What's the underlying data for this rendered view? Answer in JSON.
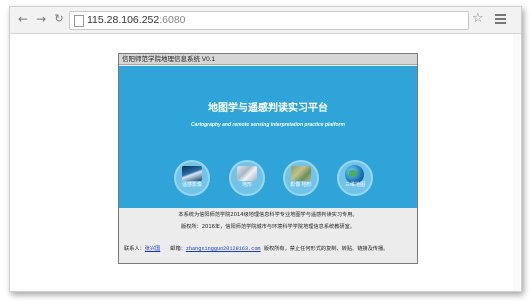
{
  "browser": {
    "back_icon": "back-arrow-icon",
    "forward_icon": "forward-arrow-icon",
    "reload_icon": "reload-icon",
    "url_host": "115.28.106.252",
    "url_port": ":6080",
    "bookmark_icon": "star-icon",
    "menu_icon": "hamburger-menu-icon"
  },
  "app": {
    "window_title": "信阳师范学院地理信息系统 V0.1",
    "title": "地图学与遥感判读实习平台",
    "subtitle": "Cartography and remote sensing interpretation practice platform",
    "panel_color": "#2fa4d8",
    "modules": [
      {
        "label": "遥感影像",
        "icon": "satellite-image-icon"
      },
      {
        "label": "地形",
        "icon": "terrain-map-icon"
      },
      {
        "label": "影像·地形",
        "icon": "image-terrain-icon"
      },
      {
        "label": "三维地图",
        "icon": "globe-icon"
      }
    ]
  },
  "footer": {
    "line1": "本系统为信阳师范学院2014级地理信息科学专业地图学与遥感判读实习专用。",
    "line2": "版权所：2016年，信阳师范学院城市与环境科学学院地理信息系统教研室。",
    "contact_label": "联系人：",
    "contact_name": "张兴国",
    "email_label": "邮箱：",
    "email": "zhangxingguo20128163.com",
    "rights": "版权所有，禁止任何形式的复制、转贴、链接及传播。"
  }
}
